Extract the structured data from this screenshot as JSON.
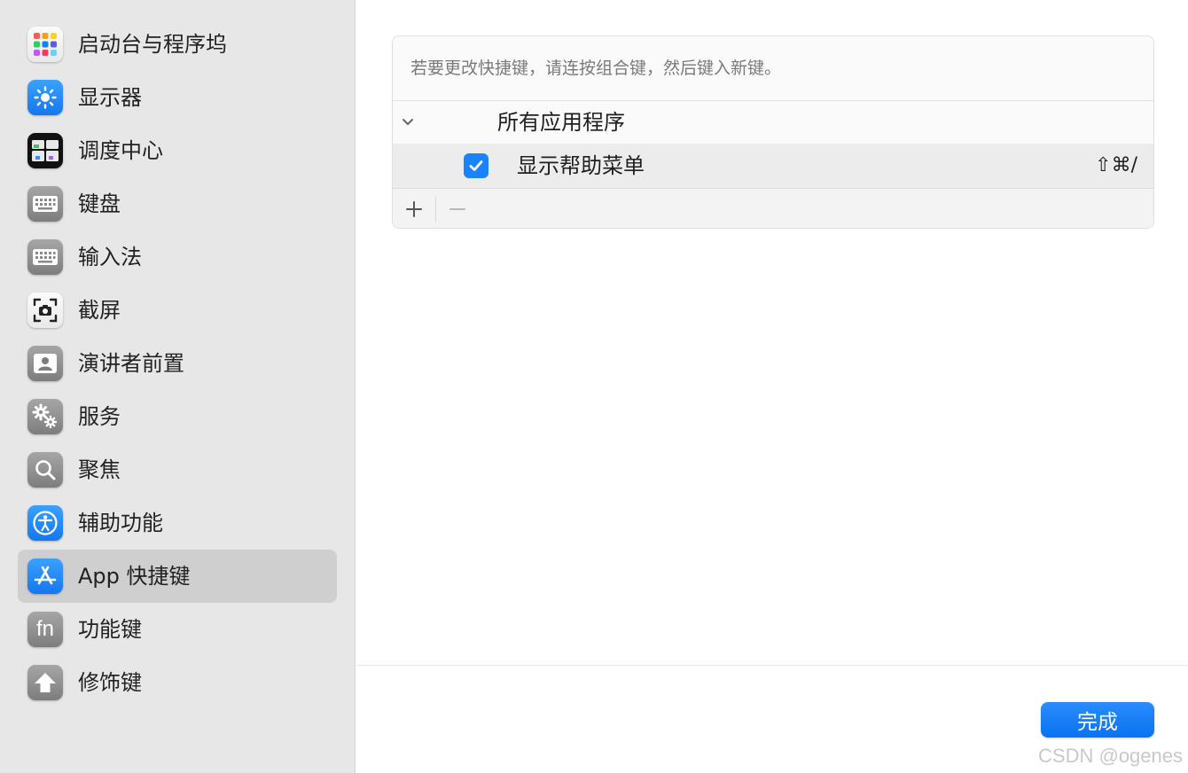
{
  "sidebar": {
    "items": [
      {
        "label": "启动台与程序坞",
        "icon": "launchpad-icon"
      },
      {
        "label": "显示器",
        "icon": "display-icon"
      },
      {
        "label": "调度中心",
        "icon": "mission-control-icon"
      },
      {
        "label": "键盘",
        "icon": "keyboard-icon"
      },
      {
        "label": "输入法",
        "icon": "input-method-icon"
      },
      {
        "label": "截屏",
        "icon": "screenshot-icon"
      },
      {
        "label": "演讲者前置",
        "icon": "presenter-overlay-icon"
      },
      {
        "label": "服务",
        "icon": "services-icon"
      },
      {
        "label": "聚焦",
        "icon": "spotlight-icon"
      },
      {
        "label": "辅助功能",
        "icon": "accessibility-icon"
      },
      {
        "label": "App 快捷键",
        "icon": "app-store-icon",
        "selected": true
      },
      {
        "label": "功能键",
        "icon": "fn-key-icon"
      },
      {
        "label": "修饰键",
        "icon": "modifier-key-icon"
      }
    ]
  },
  "panel": {
    "hint": "若要更改快捷键，请连按组合键，然后键入新键。",
    "group_label": "所有应用程序",
    "items": [
      {
        "label": "显示帮助菜单",
        "shortcut": "⇧⌘/",
        "checked": true
      }
    ]
  },
  "icons": {
    "fn_text": "fn"
  },
  "footer": {
    "done_label": "完成"
  },
  "watermark": "CSDN @ogenes",
  "colors": {
    "accent": "#0A7AFF",
    "selected_bg": "#CFCFCF",
    "sidebar_bg": "#E7E7E7"
  }
}
